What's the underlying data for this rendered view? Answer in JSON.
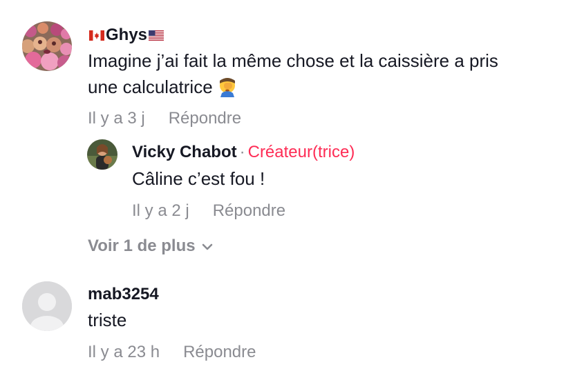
{
  "comments": [
    {
      "username": "Ghys",
      "flag_before": "canada-flag-icon",
      "flag_after": "usa-flag-icon",
      "text_line1": "Imagine j’ai fait la même chose et la caissière a pris",
      "text_line2": "une calculatrice",
      "emoji": "face-palm-emoji-icon",
      "time": "Il y a 3 j",
      "reply_label": "Répondre"
    },
    {
      "username": "Vicky Chabot",
      "separator": "·",
      "badge": "Créateur(trice)",
      "text": "Câline c’est fou !",
      "time": "Il y a 2 j",
      "reply_label": "Répondre"
    },
    {
      "username": "mab3254",
      "text": "triste",
      "time": "Il y a 23 h",
      "reply_label": "Répondre"
    }
  ],
  "view_more": {
    "label": "Voir 1 de plus",
    "icon": "chevron-down-icon"
  },
  "colors": {
    "text": "#161823",
    "muted": "#8a8b91",
    "creator": "#fe2c55",
    "avatar_placeholder": "#d9d9db"
  }
}
